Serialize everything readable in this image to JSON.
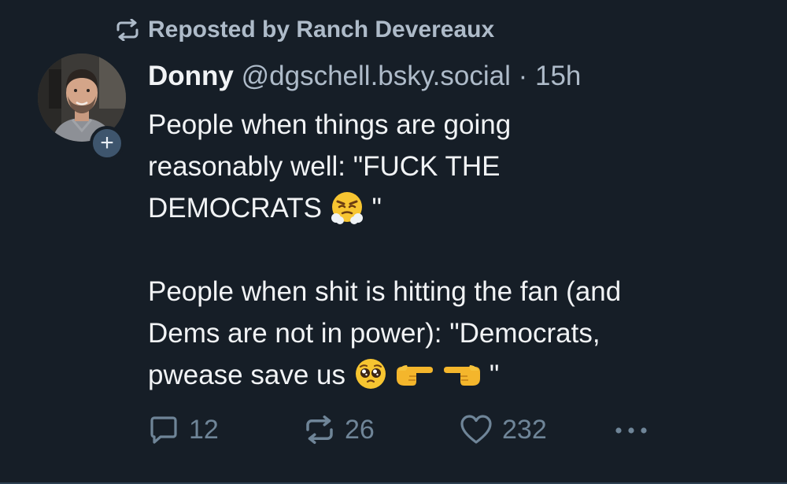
{
  "repost": {
    "prefix": "Reposted by",
    "by": "Ranch Devereaux",
    "icon": "repost-icon"
  },
  "author": {
    "display_name": "Donny",
    "handle": "@dgschell.bsky.social",
    "separator": "·",
    "time": "15h"
  },
  "body": {
    "line1": "People when things are going",
    "line2": "reasonably well: \"FUCK THE",
    "line3_text": "DEMOCRATS",
    "line3_emoji": "face-with-steam-emoji",
    "line3_end": "\"",
    "line5": "People when shit is hitting the fan (and",
    "line6": "Dems are not in power): \"Democrats,",
    "line7_text": "pwease save us",
    "line7_emojis": [
      "pleading-face-emoji",
      "pointing-right-emoji",
      "pointing-left-emoji"
    ],
    "line7_end": "\""
  },
  "stats": {
    "replies": "12",
    "reposts": "26",
    "likes": "232"
  },
  "colors": {
    "background": "#161e27",
    "text": "#f1f3f5",
    "muted": "#aebbc9",
    "action": "#6f8598",
    "badge": "#3e556d"
  }
}
